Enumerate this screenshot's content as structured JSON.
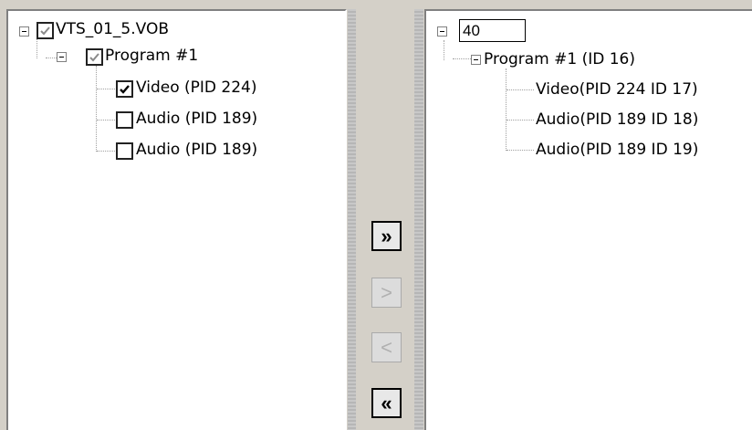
{
  "left_tree": {
    "root": {
      "label": "VTS_01_5.VOB",
      "checked": true
    },
    "program": {
      "label": "Program #1",
      "checked": true
    },
    "streams": [
      {
        "label": "Video (PID 224)",
        "checked": true
      },
      {
        "label": "Audio (PID 189)",
        "checked": false
      },
      {
        "label": "Audio (PID 189)",
        "checked": false
      }
    ]
  },
  "right_tree": {
    "root_edit_value": "40",
    "program": {
      "label": "Program #1 (ID 16)"
    },
    "streams": [
      {
        "label": "Video(PID 224 ID 17)"
      },
      {
        "label": "Audio(PID 189 ID 18)"
      },
      {
        "label": "Audio(PID 189 ID 19)"
      }
    ]
  },
  "buttons": {
    "add_all": {
      "label": "»",
      "enabled": true
    },
    "add_one": {
      "label": ">",
      "enabled": false
    },
    "remove_one": {
      "label": "<",
      "enabled": false
    },
    "remove_all": {
      "label": "«",
      "enabled": true
    }
  }
}
